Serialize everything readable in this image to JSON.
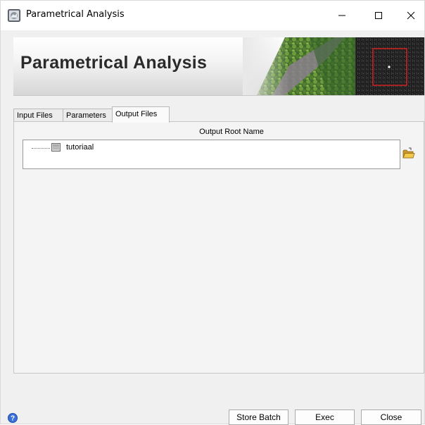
{
  "window": {
    "title": "Parametrical Analysis",
    "controls": [
      "minimize-icon",
      "maximize-icon",
      "close-icon"
    ]
  },
  "banner": {
    "title": "Parametrical Analysis"
  },
  "tabs": [
    {
      "label": "Input Files",
      "active": false
    },
    {
      "label": "Parameters",
      "active": false
    },
    {
      "label": "Output Files",
      "active": true
    }
  ],
  "output": {
    "root_label": "Output Root Name",
    "files": [
      {
        "name": "tutoriaal",
        "icon": "file-icon"
      }
    ],
    "browse_icon": "open-folder-icon"
  },
  "footer": {
    "help_icon": "help-icon",
    "store_batch": "Store Batch",
    "exec": "Exec",
    "close": "Close"
  },
  "colors": {
    "help_icon": "#3a6fd6",
    "folder_icon": "#e7b93a",
    "selection_frame": "#d42020"
  }
}
